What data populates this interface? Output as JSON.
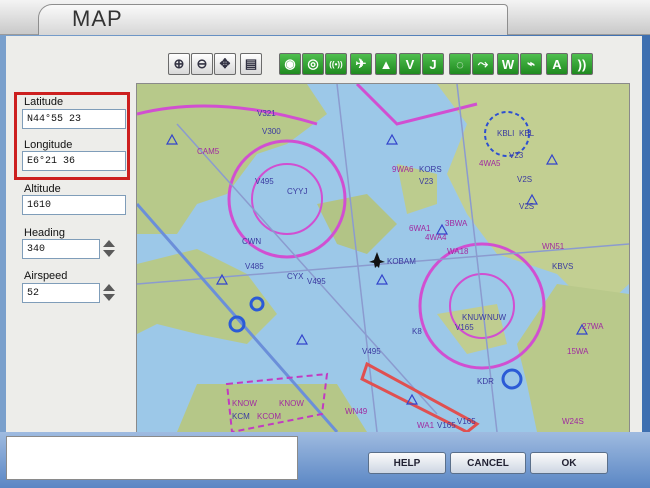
{
  "window": {
    "title": "MAP"
  },
  "fields": {
    "latitude_label": "Latitude",
    "latitude_value": "N44°55 23",
    "longitude_label": "Longitude",
    "longitude_value": "E6°21 36",
    "altitude_label": "Altitude",
    "altitude_value": "1610",
    "heading_label": "Heading",
    "heading_value": "340",
    "airspeed_label": "Airspeed",
    "airspeed_value": "52"
  },
  "toolbar": {
    "buttons": [
      {
        "icon": "zoom-in-icon",
        "glyph": "⊕"
      },
      {
        "icon": "zoom-out-icon",
        "glyph": "⊖"
      },
      {
        "icon": "center-icon",
        "glyph": "✥"
      },
      {
        "icon": "print-icon",
        "glyph": "▤"
      },
      {
        "icon": "compass-icon",
        "glyph": "◉"
      },
      {
        "icon": "vor-icon",
        "glyph": "◎"
      },
      {
        "icon": "ndb-icon",
        "glyph": "((•))"
      },
      {
        "icon": "airport-icon",
        "glyph": "✈"
      },
      {
        "icon": "triangle-icon",
        "glyph": "▲"
      },
      {
        "icon": "victor-airway-icon",
        "glyph": "V"
      },
      {
        "icon": "jet-airway-icon",
        "glyph": "J"
      },
      {
        "icon": "airspace-icon",
        "glyph": "◌"
      },
      {
        "icon": "route-icon",
        "glyph": "⤳"
      },
      {
        "icon": "waypoint-icon",
        "glyph": "W"
      },
      {
        "icon": "terrain-icon",
        "glyph": "⌁"
      },
      {
        "icon": "label-icon",
        "glyph": "A"
      },
      {
        "icon": "radar-icon",
        "glyph": "))"
      }
    ]
  },
  "map": {
    "labels": [
      "V321",
      "V300",
      "CAM5",
      "V495",
      "V23",
      "KBLI",
      "KBL",
      "V2S",
      "V165",
      "V495",
      "KNOW",
      "KNOW",
      "K8",
      "KNUW",
      "NUW",
      "9WA6",
      "KORS",
      "V23",
      "V2S",
      "4WA5",
      "WN51",
      "KBVS",
      "27WA",
      "15WA",
      "V165",
      "KDR",
      "V495",
      "WA18",
      "4WA4",
      "6WA1",
      "3BWA",
      "KOBAM",
      "CYYJ",
      "CYX",
      "CWN",
      "V485",
      "KCM",
      "KCOM",
      "WN49",
      "V165",
      "WA1",
      "W24S"
    ]
  },
  "buttons": {
    "help": "HELP",
    "cancel": "CANCEL",
    "ok": "OK"
  }
}
